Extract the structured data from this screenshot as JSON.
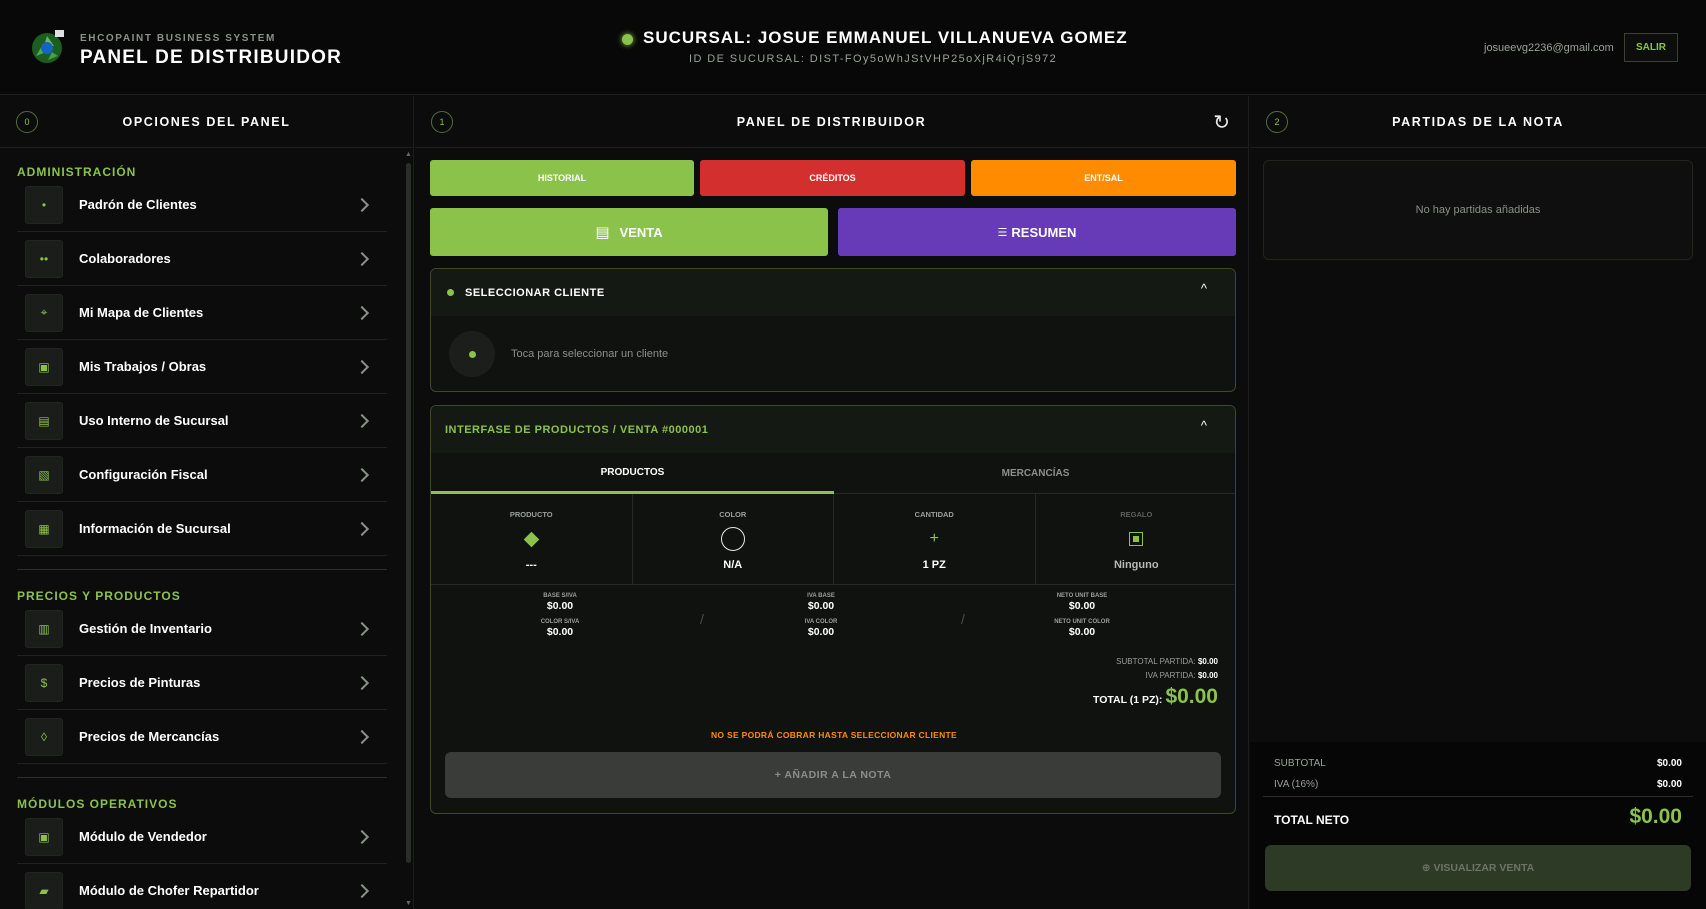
{
  "header": {
    "brand_sub": "EHCOPAINT BUSINESS SYSTEM",
    "brand_title": "PANEL DE DISTRIBUIDOR",
    "branch_title": "SUCURSAL: JOSUE EMMANUEL VILLANUEVA GOMEZ",
    "branch_id": "ID DE SUCURSAL: DIST-FOy5oWhJStVHP25oXjR4iQrjS972",
    "user_email": "josueevg2236@gmail.com",
    "logout_label": "SALIR",
    "status_color": "#8bc34a"
  },
  "left": {
    "num": "0",
    "title": "OPCIONES DEL PANEL",
    "sections": [
      {
        "title": "ADMINISTRACIÓN",
        "items": [
          {
            "label": "Padrón de Clientes",
            "icon": "•"
          },
          {
            "label": "Colaboradores",
            "icon": "••"
          },
          {
            "label": "Mi Mapa de Clientes",
            "icon": "⌖"
          },
          {
            "label": "Mis Trabajos / Obras",
            "icon": "▣"
          },
          {
            "label": "Uso Interno de Sucursal",
            "icon": "▤"
          },
          {
            "label": "Configuración Fiscal",
            "icon": "▧"
          },
          {
            "label": "Información de Sucursal",
            "icon": "▦"
          }
        ]
      },
      {
        "title": "PRECIOS Y PRODUCTOS",
        "items": [
          {
            "label": "Gestión de Inventario",
            "icon": "▥"
          },
          {
            "label": "Precios de Pinturas",
            "icon": "$"
          },
          {
            "label": "Precios de Mercancías",
            "icon": "◊"
          }
        ]
      },
      {
        "title": "MÓDULOS OPERATIVOS",
        "items": [
          {
            "label": "Módulo de Vendedor",
            "icon": "▣"
          },
          {
            "label": "Módulo de Chofer Repartidor",
            "icon": "▰"
          }
        ]
      }
    ]
  },
  "middle": {
    "num": "1",
    "title": "PANEL DE DISTRIBUIDOR",
    "refresh_icon": "↻",
    "btn_historial": "HISTORIAL",
    "btn_creditos": "CRÉDITOS",
    "btn_entsal": "ENT/SAL",
    "btn_venta": "VENTA",
    "btn_resumen": "RESUMEN",
    "cliente": {
      "title": "SELECCIONAR CLIENTE",
      "caret": "^",
      "placeholder": "Toca para seleccionar un cliente"
    },
    "productos": {
      "title": "INTERFASE DE PRODUCTOS / VENTA #000001",
      "caret": "^",
      "tabs": [
        "PRODUCTOS",
        "MERCANCÍAS"
      ],
      "attrs": [
        {
          "label": "PRODUCTO",
          "value": "---"
        },
        {
          "label": "COLOR",
          "value": "N/A"
        },
        {
          "label": "CANTIDAD",
          "value": "1 PZ",
          "icon": "+"
        },
        {
          "label": "REGALO",
          "value": "Ninguno"
        }
      ],
      "prices": [
        {
          "label": "BASE S/IVA",
          "value": "$0.00"
        },
        {
          "label": "COLOR S/IVA",
          "value": "$0.00"
        },
        {
          "label": "IVA BASE",
          "value": "$0.00"
        },
        {
          "label": "IVA COLOR",
          "value": "$0.00"
        },
        {
          "label": "NETO UNIT BASE",
          "value": "$0.00"
        },
        {
          "label": "NETO UNIT COLOR",
          "value": "$0.00"
        }
      ],
      "separator": "/",
      "subtotal_label": "SUBTOTAL PARTIDA:",
      "subtotal_value": "$0.00",
      "iva_label": "IVA PARTIDA:",
      "iva_value": "$0.00",
      "total_label": "TOTAL (1 PZ):",
      "total_value": "$0.00",
      "warning": "NO SE PODRÁ COBRAR HASTA SELECCIONAR CLIENTE",
      "add_label": "+ AÑADIR A LA NOTA"
    }
  },
  "right": {
    "num": "2",
    "title": "PARTIDAS DE LA NOTA",
    "empty": "No hay partidas añadidas",
    "subtotal_label": "SUBTOTAL",
    "subtotal_value": "$0.00",
    "iva_label": "IVA (16%)",
    "iva_value": "$0.00",
    "net_label": "TOTAL NETO",
    "net_value": "$0.00",
    "view_label": "⊕ VISUALIZAR VENTA"
  }
}
